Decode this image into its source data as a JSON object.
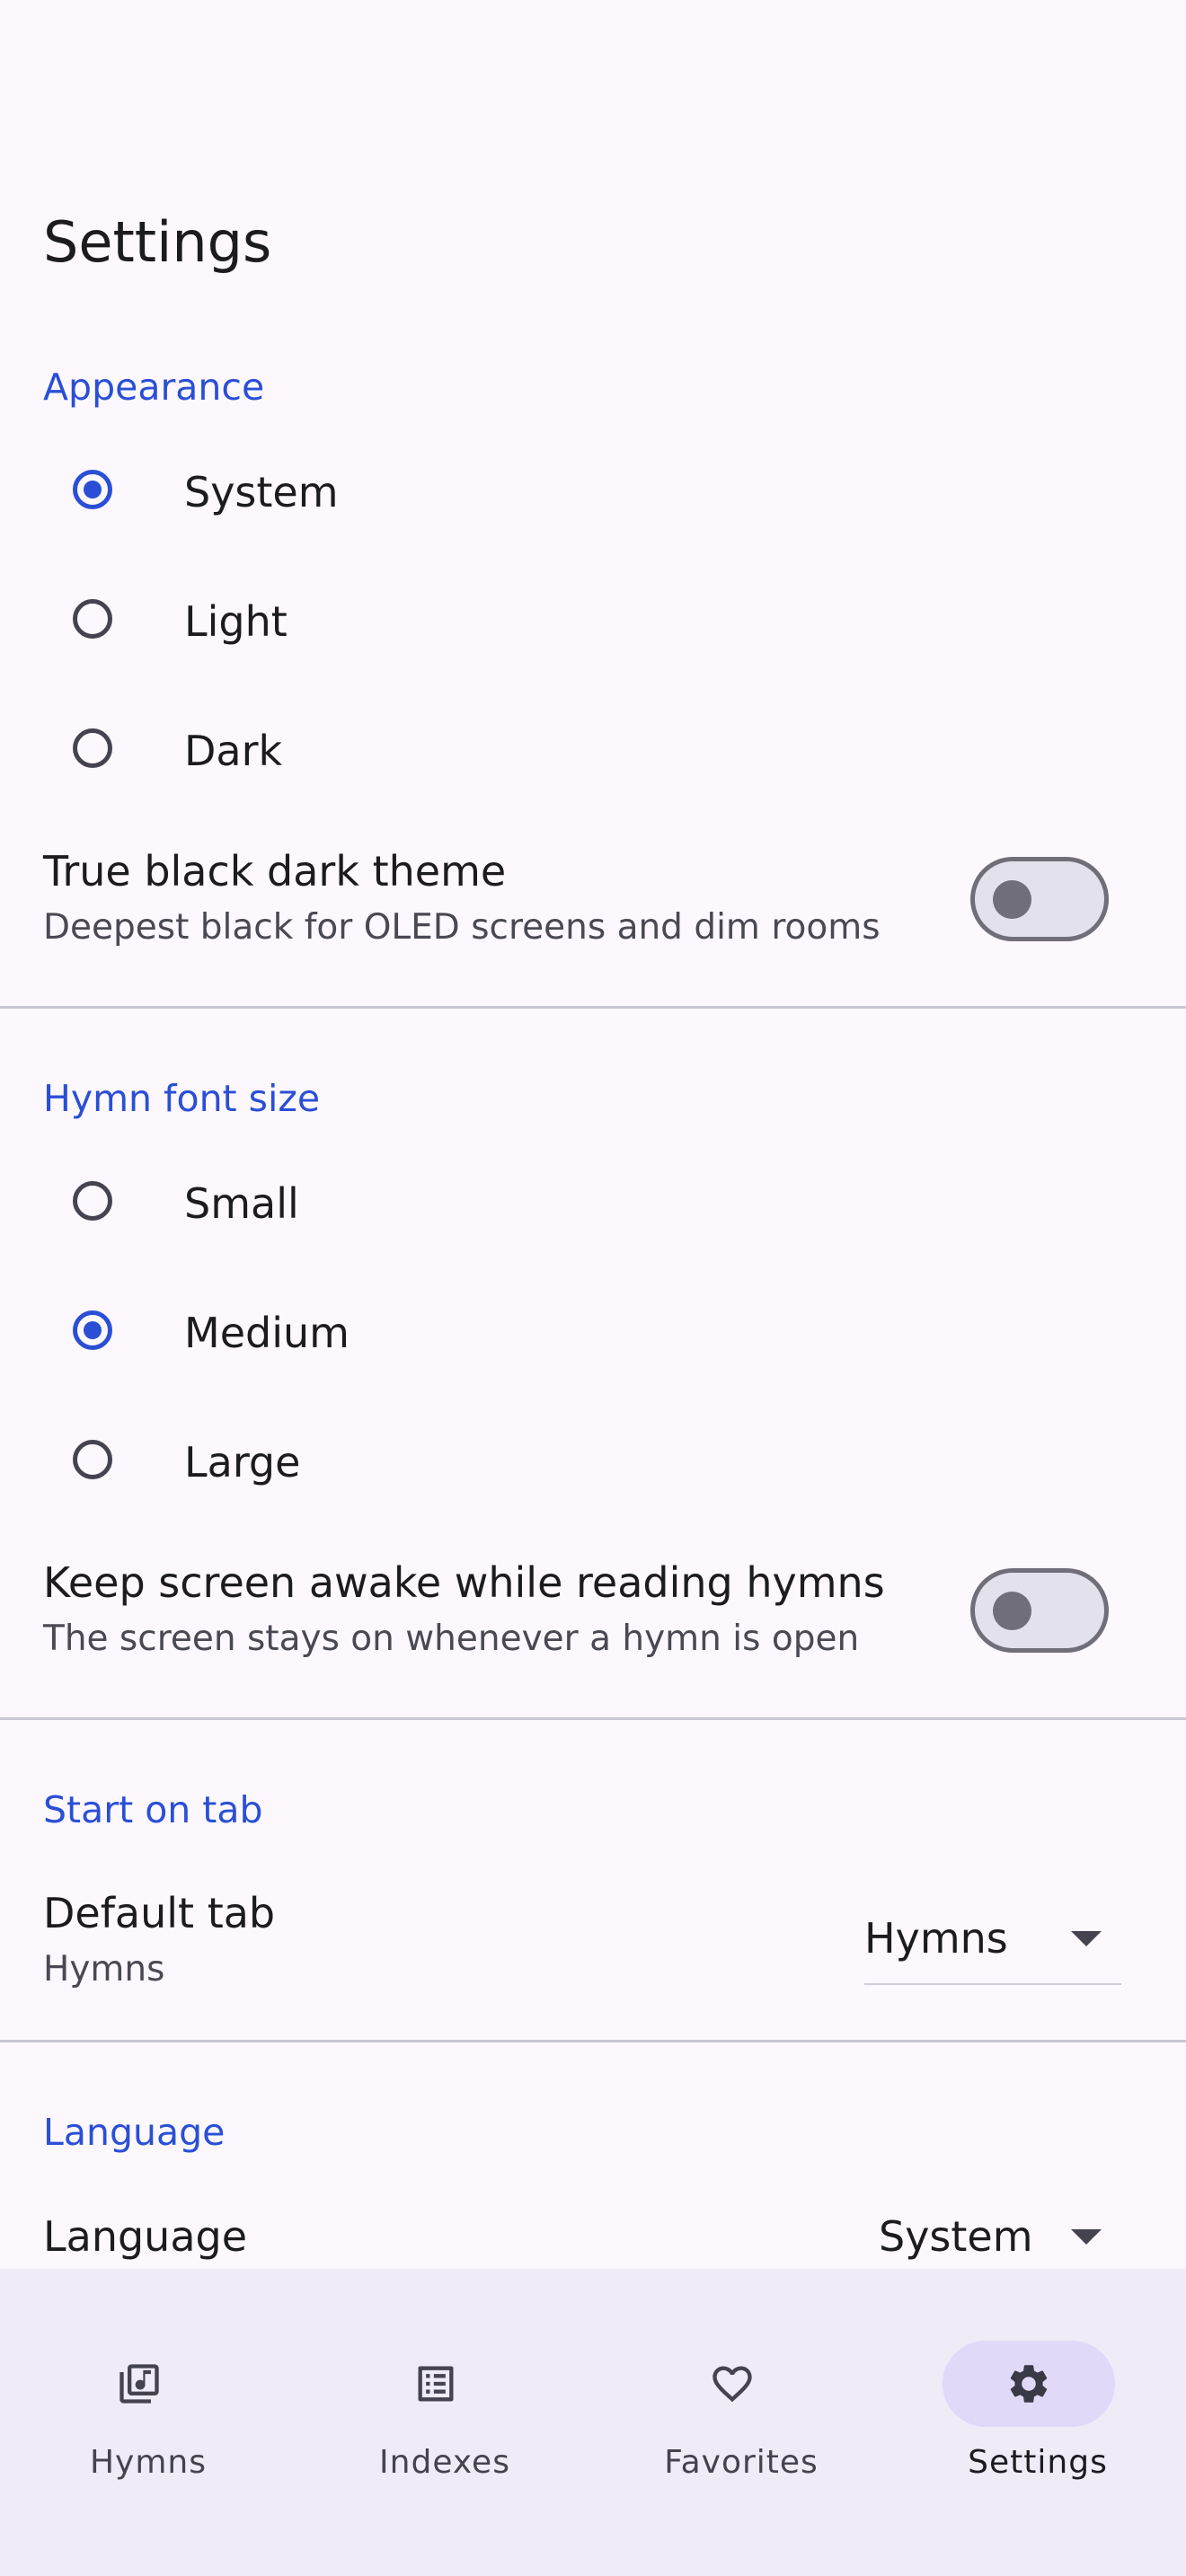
{
  "header": {
    "title": "Settings"
  },
  "appearance": {
    "heading": "Appearance",
    "options": [
      {
        "label": "System",
        "checked": true
      },
      {
        "label": "Light",
        "checked": false
      },
      {
        "label": "Dark",
        "checked": false
      }
    ],
    "true_black": {
      "title": "True black dark theme",
      "subtitle": "Deepest black for OLED screens and dim rooms",
      "on": false
    }
  },
  "font_size": {
    "heading": "Hymn font size",
    "options": [
      {
        "label": "Small",
        "checked": false
      },
      {
        "label": "Medium",
        "checked": true
      },
      {
        "label": "Large",
        "checked": false
      }
    ],
    "keep_awake": {
      "title": "Keep screen awake while reading hymns",
      "subtitle": "The screen stays on whenever a hymn is open",
      "on": false
    }
  },
  "start_tab": {
    "heading": "Start on tab",
    "title": "Default tab",
    "subtitle": "Hymns",
    "selected": "Hymns"
  },
  "language": {
    "heading": "Language",
    "title": "Language",
    "selected": "System"
  },
  "bottom_nav": {
    "items": [
      {
        "label": "Hymns",
        "icon": "music-library-icon",
        "active": false
      },
      {
        "label": "Indexes",
        "icon": "list-icon",
        "active": false
      },
      {
        "label": "Favorites",
        "icon": "heart-icon",
        "active": false
      },
      {
        "label": "Settings",
        "icon": "gear-icon",
        "active": true
      }
    ]
  },
  "colors": {
    "accent": "#2a4fd6",
    "background": "#fcf8fd",
    "nav_background": "#efecf7",
    "active_pill": "#e1d9f8"
  }
}
